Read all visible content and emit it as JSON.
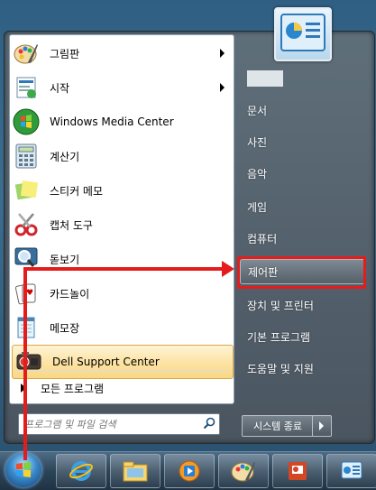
{
  "left_programs": [
    {
      "label": "그림판",
      "icon": "paint-icon",
      "submenu": true
    },
    {
      "label": "시작",
      "icon": "getting-started-icon",
      "submenu": true
    },
    {
      "label": "Windows Media Center",
      "icon": "windows-media-center-icon",
      "submenu": false
    },
    {
      "label": "계산기",
      "icon": "calculator-icon",
      "submenu": false
    },
    {
      "label": "스티커 메모",
      "icon": "sticky-notes-icon",
      "submenu": false
    },
    {
      "label": "캡처 도구",
      "icon": "snipping-tool-icon",
      "submenu": false
    },
    {
      "label": "돋보기",
      "icon": "magnifier-icon",
      "submenu": false
    },
    {
      "label": "카드놀이",
      "icon": "solitaire-icon",
      "submenu": false
    },
    {
      "label": "메모장",
      "icon": "notepad-icon",
      "submenu": false
    },
    {
      "label": "Dell Support Center",
      "icon": "dell-support-icon",
      "submenu": false,
      "highlighted": true
    }
  ],
  "all_programs_label": "모든 프로그램",
  "search": {
    "placeholder": "프로그램 및 파일 검색"
  },
  "right_items": [
    {
      "label": "문서"
    },
    {
      "label": "사진"
    },
    {
      "label": "음악"
    },
    {
      "label": "게임"
    },
    {
      "label": "컴퓨터"
    },
    {
      "label": "제어판",
      "selected": true
    },
    {
      "label": "장치 및 프린터"
    },
    {
      "label": "기본 프로그램"
    },
    {
      "label": "도움말 및 지원"
    }
  ],
  "shutdown_label": "시스템 종료",
  "taskbar_items": [
    "internet-explorer-icon",
    "windows-explorer-icon",
    "media-player-icon",
    "paint-icon",
    "powerpoint-icon",
    "control-panel-icon"
  ],
  "colors": {
    "annotation_red": "#e41c1c",
    "highlight": "#fce4a6"
  }
}
